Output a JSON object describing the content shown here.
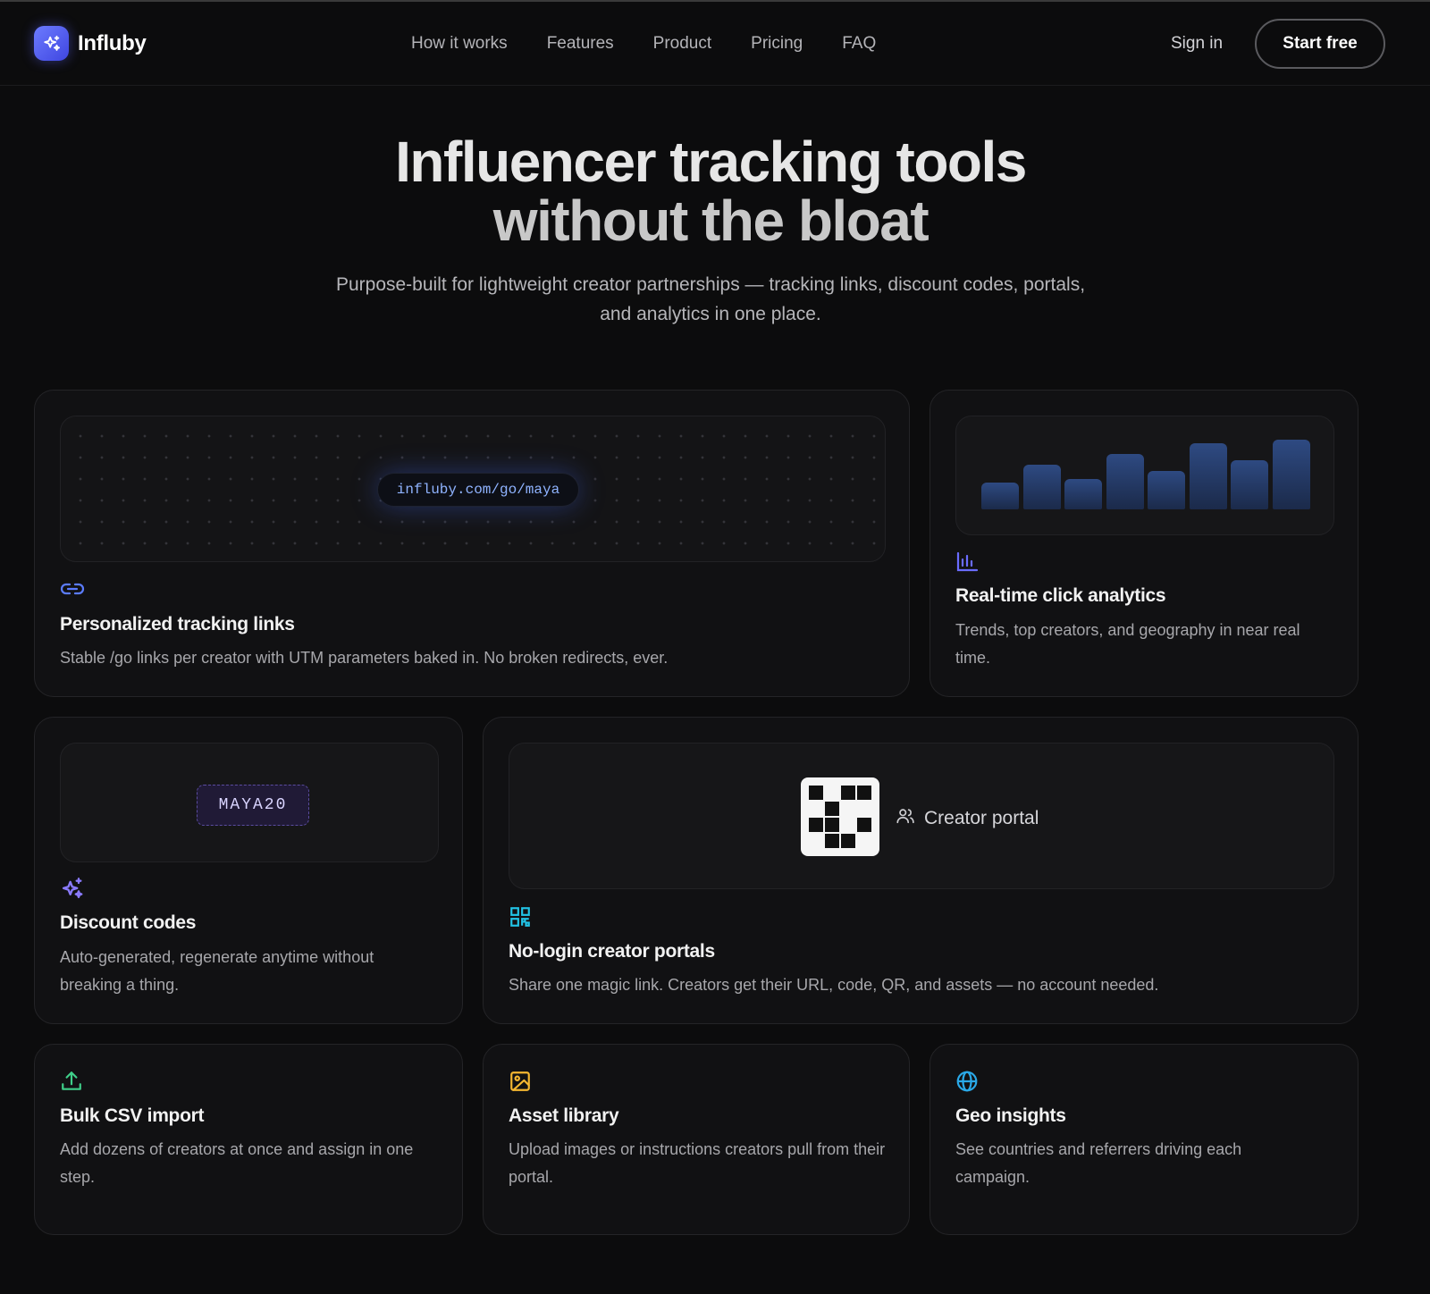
{
  "brand": {
    "name": "Influby"
  },
  "nav": {
    "links": [
      "How it works",
      "Features",
      "Product",
      "Pricing",
      "FAQ"
    ],
    "signin": "Sign in",
    "cta": "Start free"
  },
  "hero": {
    "title_line1": "Influencer tracking tools",
    "title_line2": "without the bloat",
    "subtitle_line1": "Purpose-built for lightweight creator partnerships — tracking links, discount codes, portals,",
    "subtitle_line2": "and analytics in one place."
  },
  "features": {
    "tracking": {
      "url": "influby.com/go/maya",
      "icon": "link-icon",
      "title": "Personalized tracking links",
      "desc": "Stable /go links per creator with UTM parameters baked in. No broken redirects, ever."
    },
    "analytics": {
      "icon": "bar-chart-icon",
      "title": "Real-time click analytics",
      "desc": "Trends, top creators, and geography in near real time.",
      "bars": [
        0.38,
        0.63,
        0.42,
        0.78,
        0.54,
        0.93,
        0.69,
        0.97
      ]
    },
    "discount": {
      "code": "MAYA20",
      "icon": "sparkles-icon",
      "title": "Discount codes",
      "desc": "Auto-generated, regenerate anytime without breaking a thing."
    },
    "portal": {
      "label": "Creator portal",
      "icon": "qr-code-icon",
      "title": "No-login creator portals",
      "desc": "Share one magic link. Creators get their URL, code, QR, and assets — no account needed."
    },
    "csv": {
      "icon": "upload-icon",
      "title": "Bulk CSV import",
      "desc": "Add dozens of creators at once and assign in one step."
    },
    "assets": {
      "icon": "image-icon",
      "title": "Asset library",
      "desc": "Upload images or instructions creators pull from their portal."
    },
    "geo": {
      "icon": "globe-icon",
      "title": "Geo insights",
      "desc": "See countries and referrers driving each campaign."
    }
  },
  "colors": {
    "background": "#0c0c0d",
    "card": "#111113",
    "accent_blue": "#5b7cff",
    "accent_purple": "#8b7bff",
    "accent_cyan": "#22c3e6",
    "accent_green": "#3fd08a",
    "accent_amber": "#f5b731",
    "accent_sky": "#2aa9e8"
  }
}
